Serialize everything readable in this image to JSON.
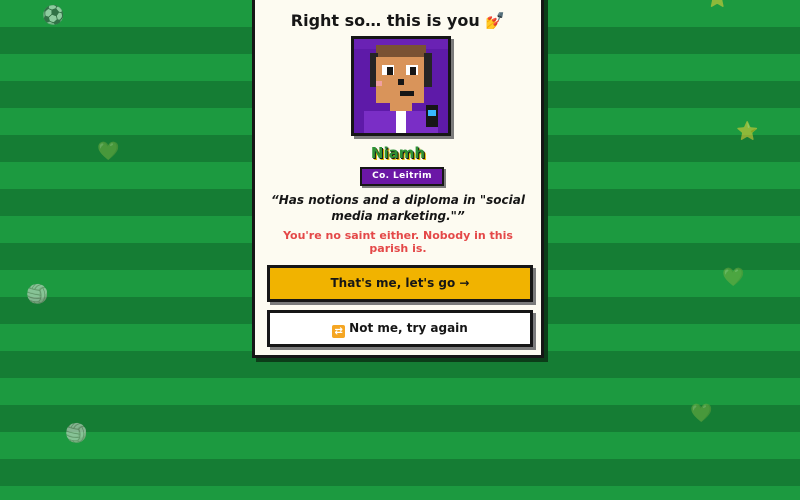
{
  "screen": {
    "title": "Right so… this is you",
    "title_emoji": "💅"
  },
  "character": {
    "name": "Niamh",
    "county": "Co. Leitrim",
    "quote": "“Has notions and a diploma in \"social media marketing.\"”",
    "retort": "You're no saint either. Nobody in this parish is."
  },
  "buttons": {
    "confirm_label": "That's me, let's go →",
    "retry_icon": "🔀",
    "retry_label": "Not me, try again"
  },
  "decorations": {
    "icons": [
      "⚽",
      "💚",
      "⭐",
      "🏐",
      "💚",
      "💚",
      "🏐",
      "⭐"
    ]
  },
  "colors": {
    "pitch_light": "#1c9a40",
    "pitch_dark": "#157d34",
    "card": "#fdfbf1",
    "accent_gold": "#f1b300",
    "county_purple": "#6b17a6",
    "retort_red": "#e44848",
    "name_green": "#2f9236"
  }
}
